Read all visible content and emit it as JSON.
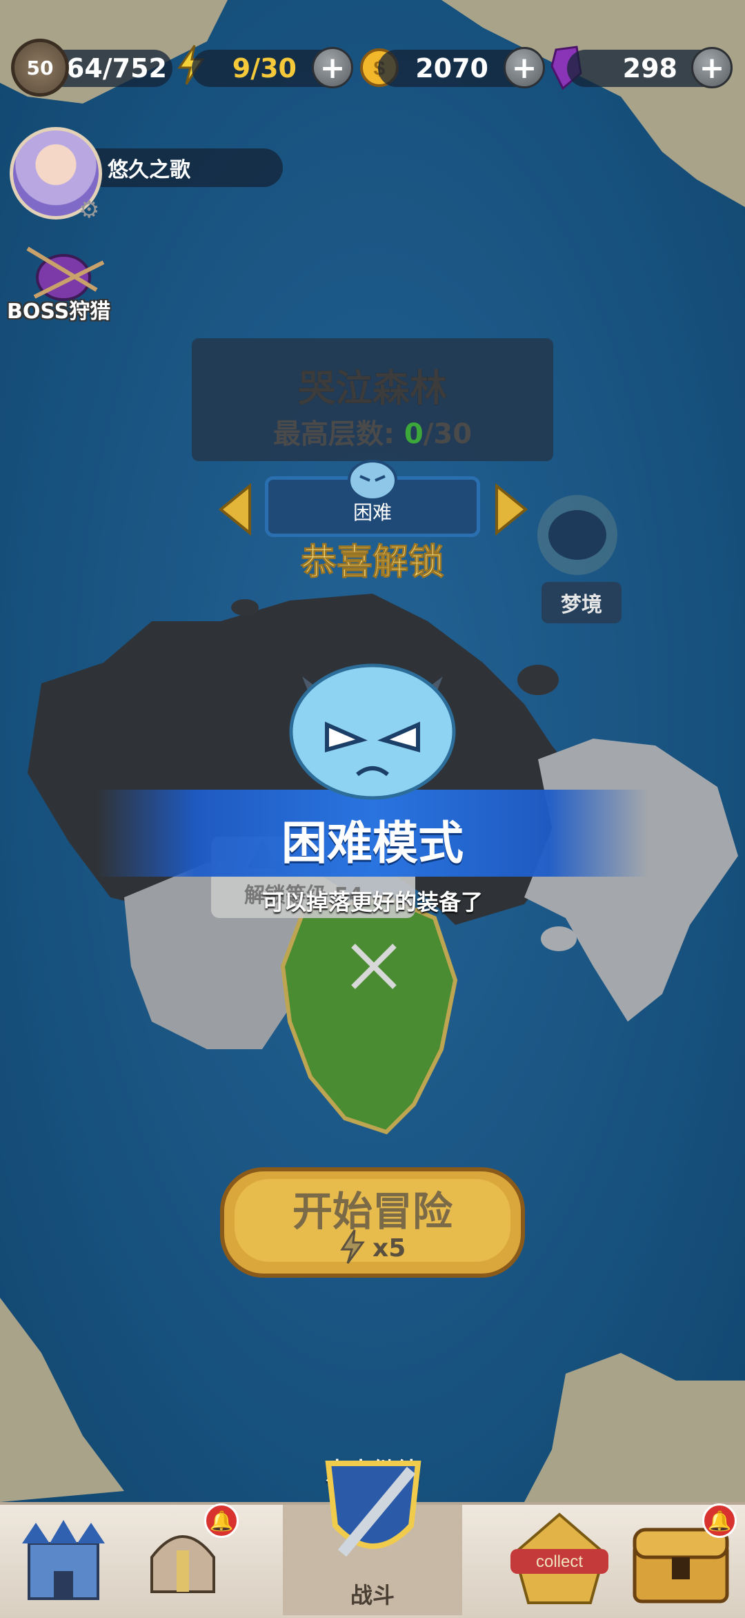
{
  "resources": {
    "level": "50",
    "exp": "264/752",
    "energy": "9/30",
    "gold": "2070",
    "gems": "298",
    "plus": "+"
  },
  "player": {
    "name": "悠久之歌"
  },
  "side": {
    "boss_hunt": "BOSS狩猎"
  },
  "stage": {
    "name": "哭泣森林",
    "max_floor_label": "最高层数:",
    "floor_current": "0",
    "floor_total": "/30",
    "difficulty": "困难",
    "dream_label": "梦境"
  },
  "popup": {
    "unlock_text": "恭喜解锁",
    "mode_title": "困难模式",
    "mode_desc": "可以掉落更好的装备了",
    "locked_text": "解锁等级 54",
    "continue_text": "点击继续"
  },
  "start": {
    "label": "开始冒险",
    "cost": "x5"
  },
  "nav": {
    "battle_label": "战斗",
    "collect_label": "collect"
  },
  "colors": {
    "ocean": "#1e5d92",
    "banner": "#2a74e0",
    "unlock_gold": "#f6dc7e",
    "green_text": "#3da83a"
  }
}
